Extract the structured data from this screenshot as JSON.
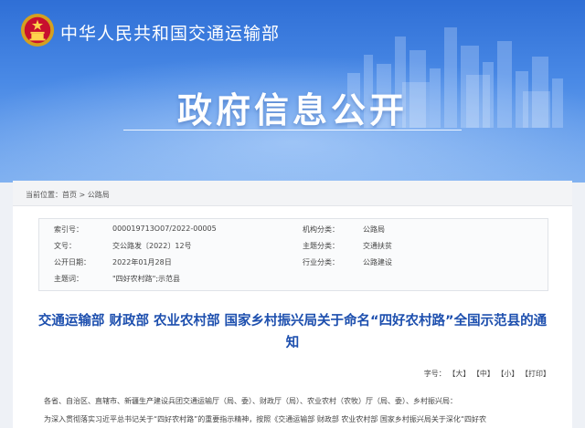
{
  "header": {
    "ministry_name": "中华人民共和国交通运输部",
    "section_title": "政府信息公开",
    "emblem": "national-emblem"
  },
  "breadcrumb": {
    "prefix": "当前位置：",
    "home": "首页",
    "separator": " > ",
    "current": "公路局"
  },
  "meta": {
    "index_label": "索引号：",
    "index_value": "000019713O07/2022-00005",
    "doc_no_label": "文号：",
    "doc_no_value": "交公路发〔2022〕12号",
    "date_label": "公开日期：",
    "date_value": "2022年01月28日",
    "keywords_label": "主题词：",
    "keywords_value": "\"四好农村路\";示范县",
    "org_label": "机构分类：",
    "org_value": "公路局",
    "topic_label": "主题分类：",
    "topic_value": "交通扶贫",
    "industry_label": "行业分类：",
    "industry_value": "公路建设"
  },
  "document": {
    "title": "交通运输部 财政部 农业农村部 国家乡村振兴局关于命名“四好农村路”全国示范县的通知",
    "font_size_label": "字号：",
    "font_large": "【大】",
    "font_medium": "【中】",
    "font_small": "【小】",
    "print": "【打印】",
    "paragraph_1": "各省、自治区、直辖市、新疆生产建设兵团交通运输厅（局、委）、财政厅（局）、农业农村（农牧）厅（局、委）、乡村振兴局：",
    "paragraph_2": "为深入贯彻落实习近平总书记关于“四好农村路”的重要指示精神，按照《交通运输部 财政部 农业农村部 国家乡村振兴局关于深化“四好农"
  },
  "colors": {
    "banner_top": "#2f6fd6",
    "title_blue": "#1d4fae",
    "panel_bg": "#ffffff",
    "page_bg": "#eef1f6"
  }
}
